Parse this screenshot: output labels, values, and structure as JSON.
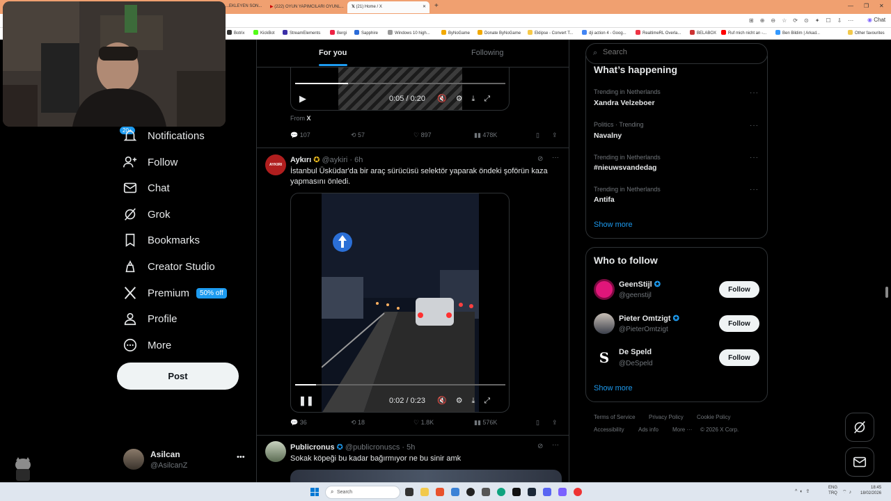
{
  "browser": {
    "tabs": [
      {
        "label": "...EKLEYEN SON..."
      },
      {
        "label": "(222) OYUN YAPIMCILARI OYUNL..."
      },
      {
        "label": "(21) Home / X"
      }
    ],
    "bookmarks": [
      "Botrix",
      "KickBot",
      "StreamElements",
      "Bergi",
      "Sapphire",
      "Windows 10 high...",
      "ByNoGame",
      "Donate ByNoGame",
      "Eklipse - Convert T...",
      "dji action 4 - Goog...",
      "RealtimeRL Overla...",
      "BELABOX",
      "Ruf mich nicht an -...",
      "Ben Bildim | Arkad...",
      "Other favourites"
    ],
    "chat_label": "Chat"
  },
  "nav": {
    "notifications_badge": "20+",
    "items": [
      {
        "label": "Notifications"
      },
      {
        "label": "Follow"
      },
      {
        "label": "Chat"
      },
      {
        "label": "Grok"
      },
      {
        "label": "Bookmarks"
      },
      {
        "label": "Creator Studio"
      },
      {
        "label": "Premium"
      },
      {
        "label": "Profile"
      },
      {
        "label": "More"
      }
    ],
    "premium_badge": "50% off",
    "post_label": "Post",
    "account": {
      "name": "Asilcan",
      "handle": "@AsilcanZ"
    }
  },
  "feed": {
    "tabs": {
      "for_you": "For you",
      "following": "Following"
    },
    "post0": {
      "video_time": "0:05 / 0:20",
      "video_progress": 0.25,
      "from_label": "From",
      "from_source": "X",
      "replies": "107",
      "reposts": "57",
      "likes": "897",
      "views": "478K"
    },
    "post1": {
      "avatar_text": "AYKIRI",
      "name": "Aykırı",
      "handle": "@aykiri",
      "time": "· 6h",
      "text": "İstanbul Üsküdar'da bir araç sürücüsü selektör yaparak öndeki şoförün kaza yapmasını önledi.",
      "video_time": "0:02 / 0:23",
      "video_progress": 0.1,
      "replies": "36",
      "reposts": "18",
      "likes": "1.8K",
      "views": "576K"
    },
    "post2": {
      "name": "Publicronus",
      "handle": "@publicronuscs",
      "time": "· 5h",
      "text": "Sokak köpeği bu kadar bağırmıyor ne bu sinir amk"
    }
  },
  "right": {
    "search_placeholder": "Search",
    "happening_title": "What’s happening",
    "trends": [
      {
        "category": "Trending in Netherlands",
        "name": "Xandra Velzeboer"
      },
      {
        "category": "Politics · Trending",
        "name": "Navalny"
      },
      {
        "category": "Trending in Netherlands",
        "name": "#nieuwsvandedag"
      },
      {
        "category": "Trending in Netherlands",
        "name": "Antifa"
      }
    ],
    "show_more": "Show more",
    "who_title": "Who to follow",
    "follows": [
      {
        "name": "GeenStijl",
        "handle": "@geenstijl",
        "button": "Follow"
      },
      {
        "name": "Pieter Omtzigt",
        "handle": "@PieterOmtzigt",
        "button": "Follow"
      },
      {
        "name": "De Speld",
        "handle": "@DeSpeld",
        "button": "Follow"
      }
    ],
    "show_more_2": "Show more",
    "footer": [
      "Terms of Service",
      "Privacy Policy",
      "Cookie Policy",
      "Accessibility",
      "Ads info",
      "More ···",
      "© 2026 X Corp."
    ]
  },
  "taskbar": {
    "search_placeholder": "Search",
    "lang": "ENG",
    "lang2": "TRQ",
    "time": "18:45",
    "date": "18/02/2026"
  },
  "colors": {
    "accent": "#1d9bf0",
    "background": "#000000",
    "border": "#2f3336",
    "muted": "#71767b"
  }
}
